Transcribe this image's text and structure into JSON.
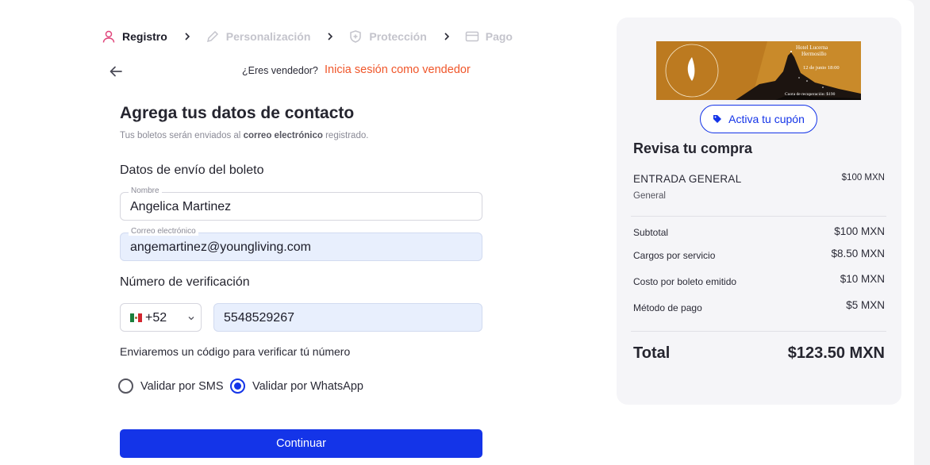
{
  "stepper": {
    "steps": [
      {
        "label": "Registro",
        "icon": "user-icon",
        "active": true
      },
      {
        "label": "Personalización",
        "icon": "pencil-icon",
        "active": false
      },
      {
        "label": "Protección",
        "icon": "shield-plus-icon",
        "active": false
      },
      {
        "label": "Pago",
        "icon": "credit-card-icon",
        "active": false
      }
    ]
  },
  "seller": {
    "question": "¿Eres vendedor?",
    "link": "Inicia sesión como vendedor"
  },
  "form": {
    "title": "Agrega tus datos de contacto",
    "subtitle_pre": "Tus boletos serán enviados al ",
    "subtitle_bold": "correo electrónico",
    "subtitle_post": " registrado.",
    "shipping_title": "Datos de envío del boleto",
    "name_label": "Nombre",
    "name_value": "Angelica Martinez",
    "email_label": "Correo electrónico",
    "email_value": "angemartinez@youngliving.com",
    "verification_title": "Número de verificación",
    "country_code": "+52",
    "phone_value": "5548529267",
    "verify_note": "Enviaremos un código para verificar tú número",
    "radio_sms": "Validar por SMS",
    "radio_whatsapp": "Validar por WhatsApp",
    "selected_method": "whatsapp",
    "continue_label": "Continuar"
  },
  "summary": {
    "banner_venue": "Hotel Lucerna",
    "banner_city": "Hermosillo",
    "banner_date": "12 de junio 18:00",
    "banner_fee": "Cuota de recuperación: $190",
    "coupon_label": "Activa tu cupón",
    "title": "Revisa tu compra",
    "item_name": "ENTRADA GENERAL",
    "item_type": "General",
    "item_price": "$100 MXN",
    "rows": [
      {
        "label": "Subtotal",
        "value": "$100 MXN"
      },
      {
        "label": "Cargos por servicio",
        "value": "$8.50 MXN"
      },
      {
        "label": "Costo por boleto emitido",
        "value": "$10 MXN"
      },
      {
        "label": "Método de pago",
        "value": "$5 MXN"
      }
    ],
    "total_label": "Total",
    "total_value": "$123.50 MXN"
  },
  "colors": {
    "accent": "#1434e8",
    "link": "#f0562a",
    "active_step_icon": "#e0457b",
    "filled_input": "#e8effd"
  }
}
